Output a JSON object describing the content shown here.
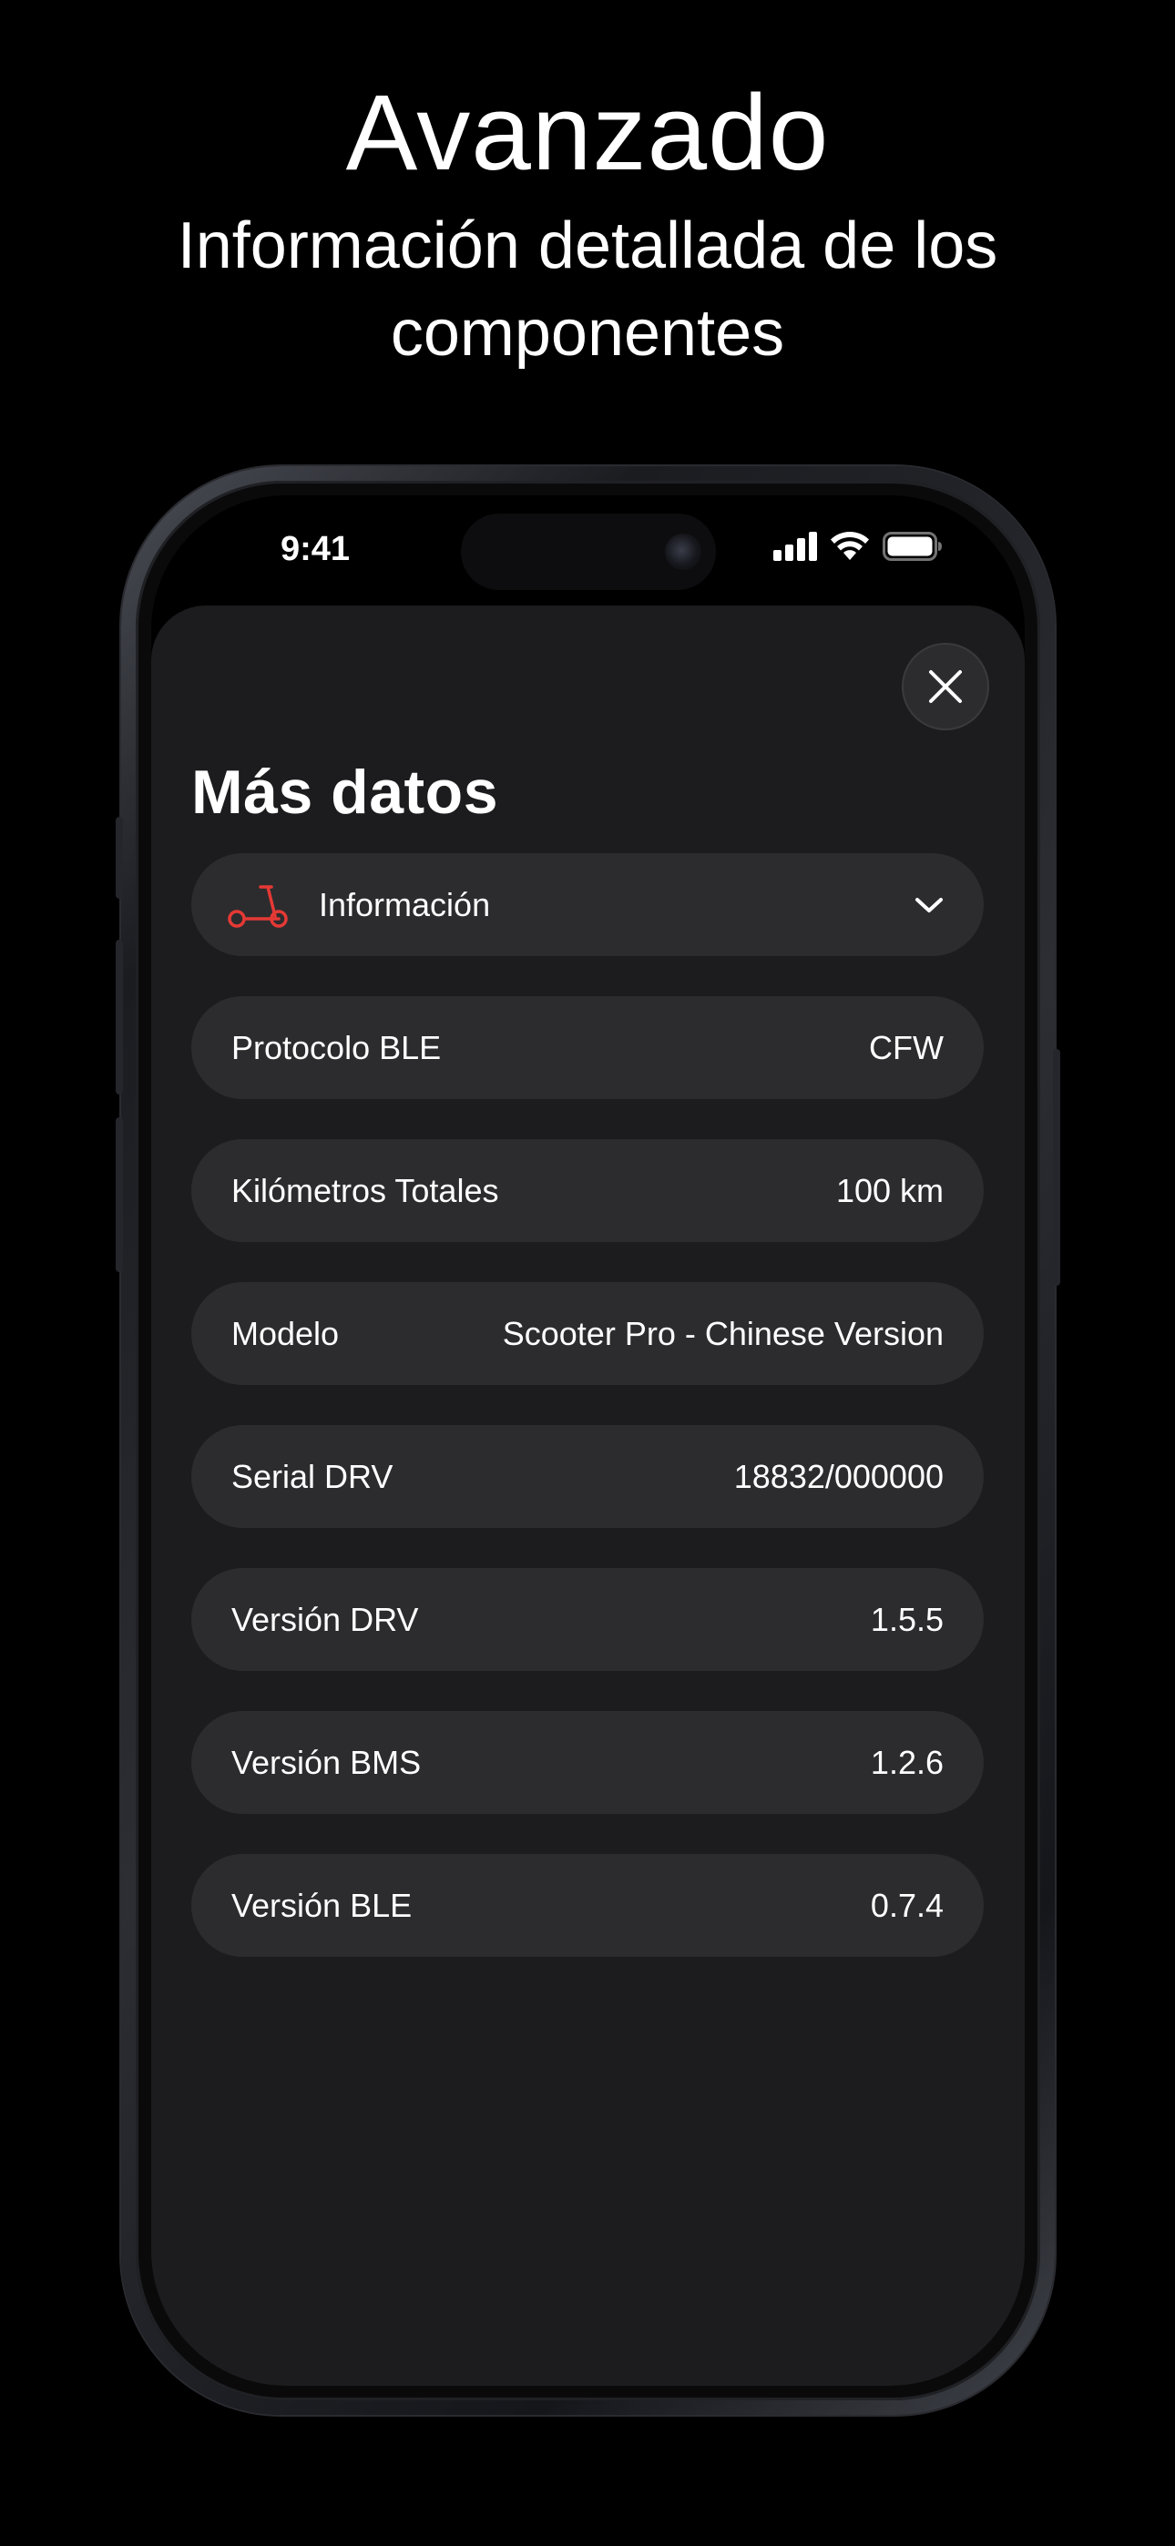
{
  "headline": "Avanzado",
  "subheadline": "Información detallada de los componentes",
  "status_bar": {
    "time": "9:41"
  },
  "sheet": {
    "title": "Más datos",
    "dropdown": {
      "label": "Información",
      "icon": "scooter-icon",
      "accent": "#e53935"
    },
    "rows": [
      {
        "label": "Protocolo BLE",
        "value": "CFW"
      },
      {
        "label": "Kilómetros Totales",
        "value": "100 km"
      },
      {
        "label": "Modelo",
        "value": "Scooter Pro - Chinese Version"
      },
      {
        "label": "Serial DRV",
        "value": "18832/000000"
      },
      {
        "label": "Versión DRV",
        "value": "1.5.5"
      },
      {
        "label": "Versión BMS",
        "value": "1.2.6"
      },
      {
        "label": "Versión BLE",
        "value": "0.7.4"
      }
    ]
  },
  "colors": {
    "background": "#000000",
    "sheet": "#1c1c1e",
    "row": "#2c2c2e",
    "text": "#ffffff"
  }
}
